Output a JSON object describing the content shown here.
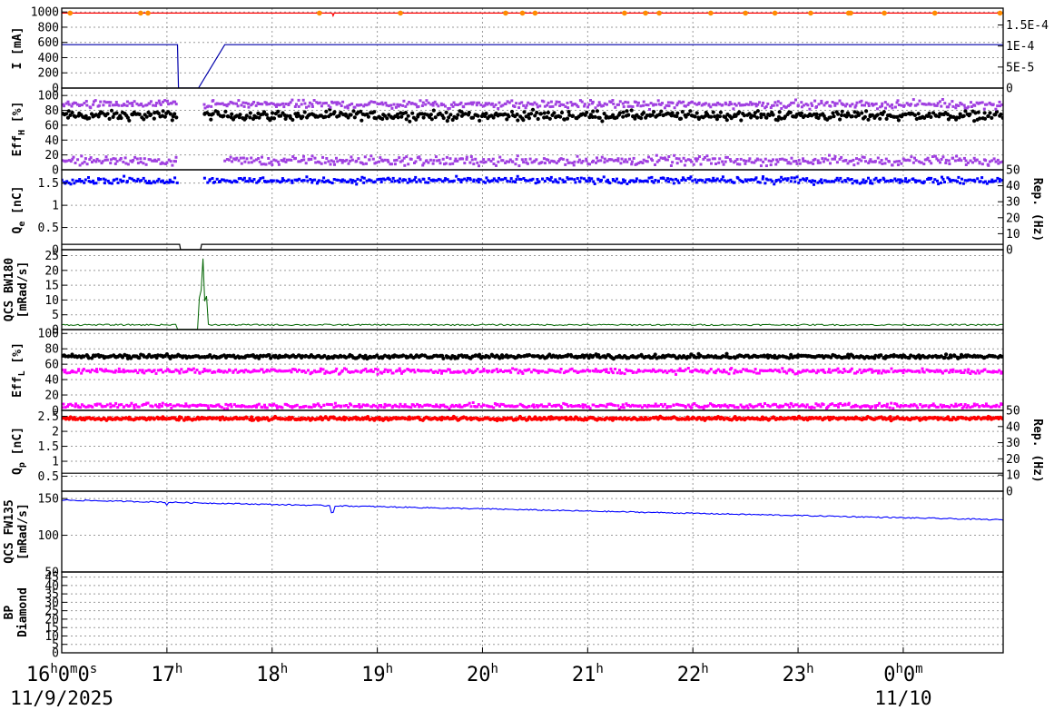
{
  "chart_data": {
    "type": "line",
    "x_range_hours": [
      16.0,
      24.95
    ],
    "x_ticks": [
      {
        "h": 16,
        "text": "16",
        "sup": "h",
        "tail": "0",
        "tail_sup": "m",
        "tail2": "0",
        "tail2_sup": "s"
      },
      {
        "h": 17,
        "text": "17",
        "sup": "h"
      },
      {
        "h": 18,
        "text": "18",
        "sup": "h"
      },
      {
        "h": 19,
        "text": "19",
        "sup": "h"
      },
      {
        "h": 20,
        "text": "20",
        "sup": "h"
      },
      {
        "h": 21,
        "text": "21",
        "sup": "h"
      },
      {
        "h": 22,
        "text": "22",
        "sup": "h"
      },
      {
        "h": 23,
        "text": "23",
        "sup": "h"
      },
      {
        "h": 24,
        "text": "0",
        "sup": "h",
        "tail": "0",
        "tail_sup": "m"
      }
    ],
    "dates": [
      {
        "text": "11/9/2025",
        "h": 16
      },
      {
        "text": "11/10",
        "h": 24
      }
    ],
    "panels": [
      {
        "id": "current",
        "ylabel": "I [mA]",
        "ylim": [
          0,
          1050
        ],
        "yticks": [
          0,
          200,
          400,
          600,
          800,
          1000
        ],
        "right_ylim": [
          0,
          0.00019
        ],
        "right_ticks": [
          "0",
          "5E-5",
          "1E-4",
          "1.5E-4"
        ],
        "right_tick_values": [
          0,
          5e-05,
          0.0001,
          0.00015
        ],
        "series": [
          {
            "kind": "line",
            "color": "#ff0000",
            "points": [
              [
                16.0,
                985
              ],
              [
                18.57,
                985
              ],
              [
                18.58,
                950
              ],
              [
                18.59,
                985
              ],
              [
                24.95,
                985
              ]
            ]
          },
          {
            "kind": "line",
            "color": "#0000aa",
            "points": [
              [
                16.0,
                570
              ],
              [
                17.1,
                570
              ],
              [
                17.11,
                0
              ],
              [
                17.3,
                0
              ],
              [
                17.55,
                570
              ],
              [
                24.95,
                570
              ]
            ]
          },
          {
            "kind": "dots",
            "color": "#ff8c00",
            "x": [
              16.08,
              16.75,
              16.82,
              18.45,
              19.22,
              20.22,
              20.38,
              20.5,
              21.35,
              21.55,
              21.68,
              22.17,
              22.5,
              22.78,
              23.12,
              23.48,
              23.5,
              23.82,
              24.3,
              24.92
            ],
            "y": 985
          }
        ]
      },
      {
        "id": "eff_h",
        "ylabel": "Eff",
        "ylabel_sub": "H",
        "ylabel_tail": " [%]",
        "ylim": [
          0,
          110
        ],
        "yticks": [
          0,
          20,
          40,
          60,
          80,
          100
        ],
        "series": [
          {
            "kind": "scatter",
            "color": "#000000",
            "center": 73,
            "spread": 6,
            "gap": [
              17.1,
              17.35
            ]
          },
          {
            "kind": "scatter",
            "color": "#a040e0",
            "center": 88,
            "spread": 5,
            "gap": [
              17.1,
              17.35
            ]
          },
          {
            "kind": "scatter",
            "color": "#a040e0",
            "center": 12,
            "spread": 6,
            "gap": [
              17.1,
              17.55
            ]
          }
        ]
      },
      {
        "id": "qe",
        "ylabel": "Q",
        "ylabel_sub": "e",
        "ylabel_tail": " [nC]",
        "ylim": [
          0,
          1.8
        ],
        "yticks": [
          0,
          0.5,
          1,
          1.5
        ],
        "right_label": "Rep. (Hz)",
        "right_ylim": [
          0,
          50
        ],
        "right_ticks": [
          "0",
          "10",
          "20",
          "30",
          "40",
          "50"
        ],
        "series": [
          {
            "kind": "scatter",
            "color": "#0000ff",
            "center": 1.56,
            "spread": 0.07,
            "gap": [
              17.1,
              17.35
            ]
          },
          {
            "kind": "line",
            "color": "#000000",
            "points": [
              [
                16.0,
                0.12
              ],
              [
                17.12,
                0.12
              ],
              [
                17.13,
                0.0
              ],
              [
                17.32,
                0.0
              ],
              [
                17.33,
                0.12
              ],
              [
                24.95,
                0.12
              ]
            ]
          }
        ]
      },
      {
        "id": "qcs_bw",
        "ylabel": "QCS BW180",
        "ylabel2": "[mRad/s]",
        "ylim": [
          0,
          27
        ],
        "yticks": [
          0,
          5,
          10,
          15,
          20,
          25
        ],
        "series": [
          {
            "kind": "line",
            "color": "#006400",
            "baseline": 1.6,
            "spike": [
              17.34,
              24.0
            ]
          }
        ]
      },
      {
        "id": "eff_l",
        "ylabel": "Eff",
        "ylabel_sub": "L",
        "ylabel_tail": " [%]",
        "ylim": [
          0,
          105
        ],
        "yticks": [
          0,
          20,
          40,
          60,
          80,
          100
        ],
        "series": [
          {
            "kind": "scatter",
            "color": "#000000",
            "center": 70,
            "spread": 2.5
          },
          {
            "kind": "scatter",
            "color": "#ff00ff",
            "center": 51,
            "spread": 3
          },
          {
            "kind": "scatter",
            "color": "#ff00ff",
            "center": 6,
            "spread": 3
          }
        ]
      },
      {
        "id": "qp",
        "ylabel": "Q",
        "ylabel_sub": "p",
        "ylabel_tail": " [nC]",
        "ylim": [
          0,
          2.7
        ],
        "yticks": [
          0.5,
          1,
          1.5,
          2,
          2.5
        ],
        "right_label": "Rep. (Hz)",
        "right_ylim": [
          0,
          50
        ],
        "right_ticks": [
          "0",
          "10",
          "20",
          "30",
          "40",
          "50"
        ],
        "series": [
          {
            "kind": "scatter",
            "color": "#ff0000",
            "center": 2.43,
            "spread": 0.05
          },
          {
            "kind": "line",
            "color": "#000000",
            "points": [
              [
                16.0,
                0.6
              ],
              [
                24.95,
                0.6
              ]
            ]
          }
        ]
      },
      {
        "id": "qcs_fw",
        "ylabel": "QCS FW135",
        "ylabel2": "[mRad/s]",
        "ylim": [
          50,
          160
        ],
        "yticks": [
          50,
          100,
          150
        ],
        "series": [
          {
            "kind": "line",
            "color": "#0000ff",
            "start": 148,
            "end": 121
          }
        ]
      },
      {
        "id": "bp",
        "ylabel": "BP",
        "ylabel2": "Diamond",
        "ylim": [
          0,
          48
        ],
        "yticks": [
          0,
          5,
          10,
          15,
          20,
          25,
          30,
          35,
          40,
          45
        ],
        "series": []
      }
    ]
  }
}
